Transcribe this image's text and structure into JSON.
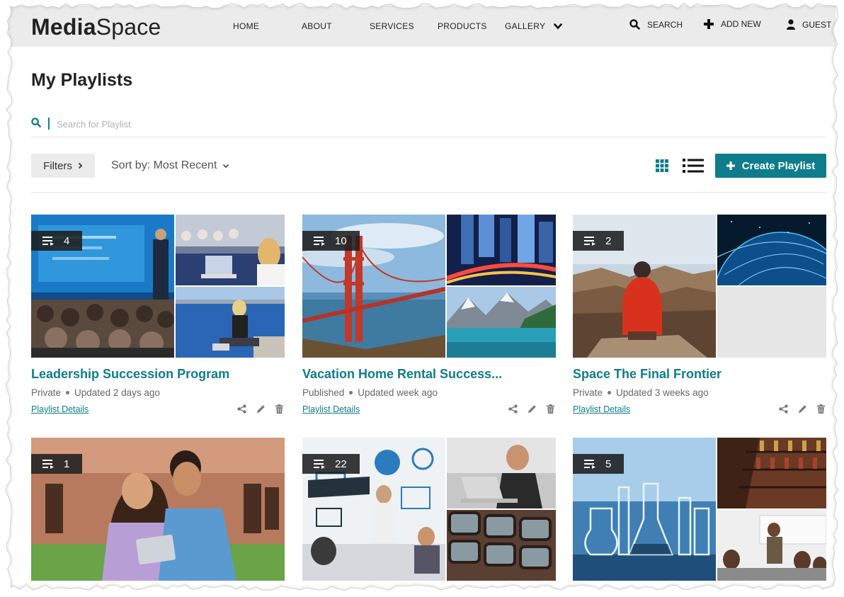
{
  "header": {
    "logo_bold": "Media",
    "logo_light": "Space",
    "nav": [
      "HOME",
      "ABOUT",
      "SERVICES",
      "PRODUCTS",
      "GALLERY"
    ],
    "search_label": "SEARCH",
    "add_new_label": "ADD NEW",
    "user_label": "GUEST"
  },
  "page": {
    "title": "My Playlists",
    "search_placeholder": "Search for Playlist"
  },
  "toolbar": {
    "filters_label": "Filters",
    "sort_label": "Sort by: Most Recent",
    "create_label": "Create Playlist"
  },
  "colors": {
    "accent": "#0e7c8a",
    "header_bg": "#ebebeb"
  },
  "playlists": [
    {
      "count": "4",
      "title": "Leadership Succession Program",
      "status": "Private",
      "updated": "Updated 2 days ago",
      "details_label": "Playlist Details"
    },
    {
      "count": "10",
      "title": "Vacation Home Rental Success...",
      "status": "Published",
      "updated": "Updated week ago",
      "details_label": "Playlist Details"
    },
    {
      "count": "2",
      "title": "Space The Final Frontier",
      "status": "Private",
      "updated": "Updated 3 weeks ago",
      "details_label": "Playlist Details"
    },
    {
      "count": "1"
    },
    {
      "count": "22"
    },
    {
      "count": "5"
    }
  ]
}
